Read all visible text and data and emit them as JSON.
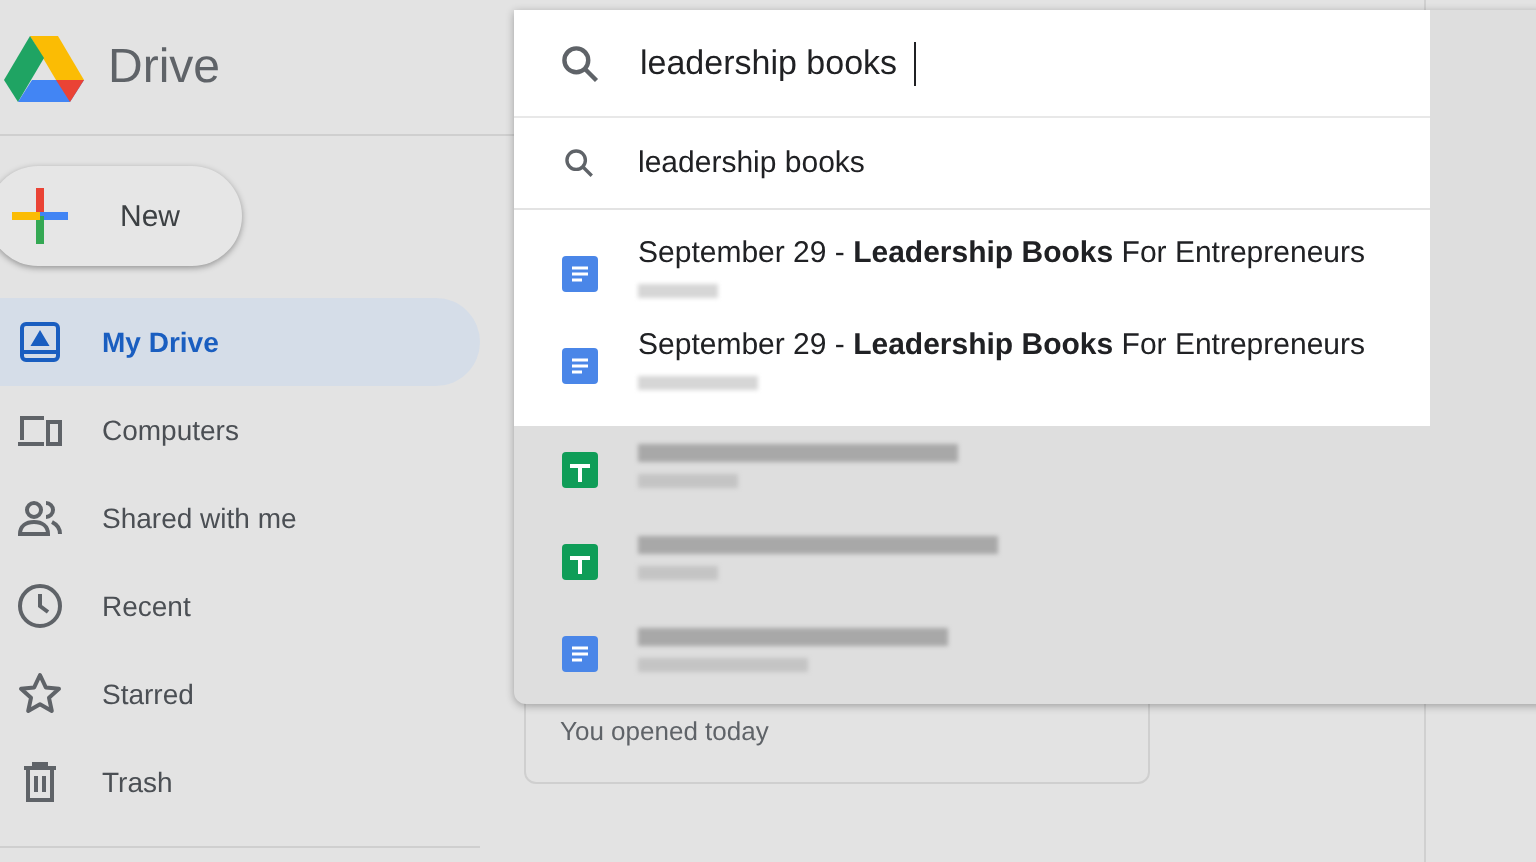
{
  "app": {
    "name": "Drive"
  },
  "new_button": {
    "label": "New"
  },
  "sidebar": {
    "items": [
      {
        "label": "My Drive",
        "kind": "drive",
        "selected": true
      },
      {
        "label": "Computers",
        "kind": "computers",
        "selected": false
      },
      {
        "label": "Shared with me",
        "kind": "people",
        "selected": false
      },
      {
        "label": "Recent",
        "kind": "clock",
        "selected": false
      },
      {
        "label": "Starred",
        "kind": "star",
        "selected": false
      },
      {
        "label": "Trash",
        "kind": "trash",
        "selected": false
      }
    ]
  },
  "search": {
    "value": "leadership books"
  },
  "suggestion": {
    "label": "leadership books"
  },
  "results": [
    {
      "kind": "doc",
      "title": "September 29 - **Leadership Books** For Entrepreneurs"
    },
    {
      "kind": "doc",
      "title": "September 29 - **Leadership Books** For Entrepreneurs"
    }
  ],
  "dimmed_results": [
    {
      "kind": "sheet"
    },
    {
      "kind": "sheet"
    },
    {
      "kind": "doc"
    }
  ],
  "card": {
    "label": "You opened today"
  }
}
